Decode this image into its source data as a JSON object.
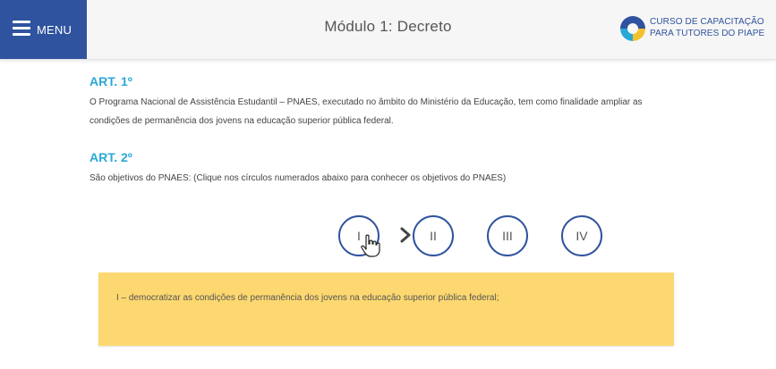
{
  "header": {
    "menu_label": "MENU",
    "title": "Módulo 1: Decreto",
    "logo_line1": "CURSO DE CAPACITAÇÃO",
    "logo_line2": "PARA TUTORES DO PIAPE"
  },
  "art1": {
    "title": "ART. 1º",
    "text": "O Programa Nacional de Assistência Estudantil – PNAES, executado no âmbito do Ministério da Educação, tem como finalidade ampliar as condições de permanência dos jovens na educação superior pública federal."
  },
  "art2": {
    "title": "ART. 2º",
    "text": "São objetivos do PNAES: (Clique nos círculos numerados abaixo para conhecer os objetivos do PNAES)"
  },
  "objectives": {
    "items": [
      "I",
      "II",
      "III",
      "IV"
    ],
    "selected": "I",
    "content": "I – democratizar as condições de permanência dos jovens na educação superior pública federal;"
  },
  "colors": {
    "brand_blue": "#2f539e",
    "heading_cyan": "#29a8d6",
    "panel_yellow": "#fdd870",
    "logo_yellow": "#f2c12e"
  }
}
